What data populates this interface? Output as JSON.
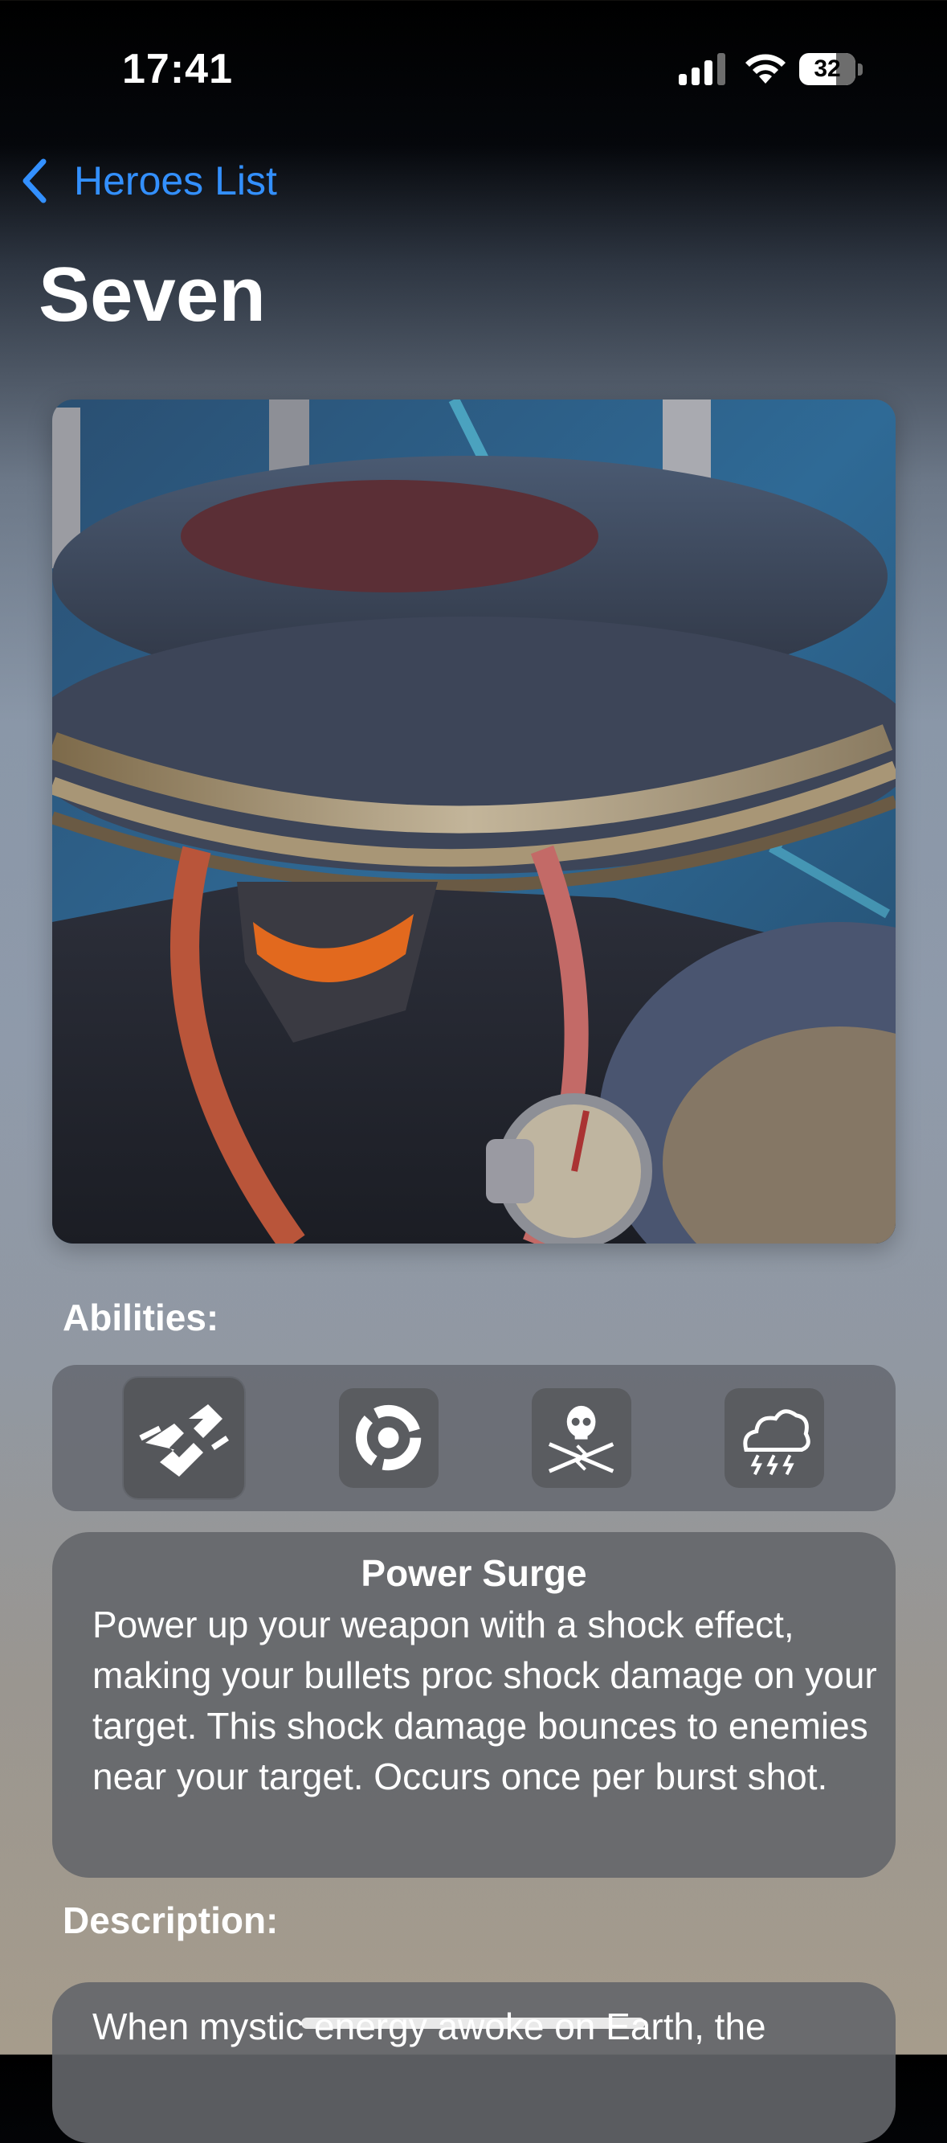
{
  "status_bar": {
    "time": "17:41",
    "battery": "32"
  },
  "nav": {
    "back_label": "Heroes List"
  },
  "page": {
    "title": "Seven"
  },
  "abilities": {
    "header": "Abilities:",
    "icons": [
      "chain-lightning-icon",
      "power-surge-icon",
      "skull-lightning-icon",
      "storm-cloud-icon"
    ],
    "selected": {
      "name": "Power Surge",
      "description": "Power up your weapon with a shock effect, making your bullets proc shock damage on your target. This shock damage bounces to enemies near your target. Occurs once per burst shot."
    }
  },
  "description": {
    "header": "Description:",
    "text": "When mystic energy awoke on Earth, the"
  }
}
